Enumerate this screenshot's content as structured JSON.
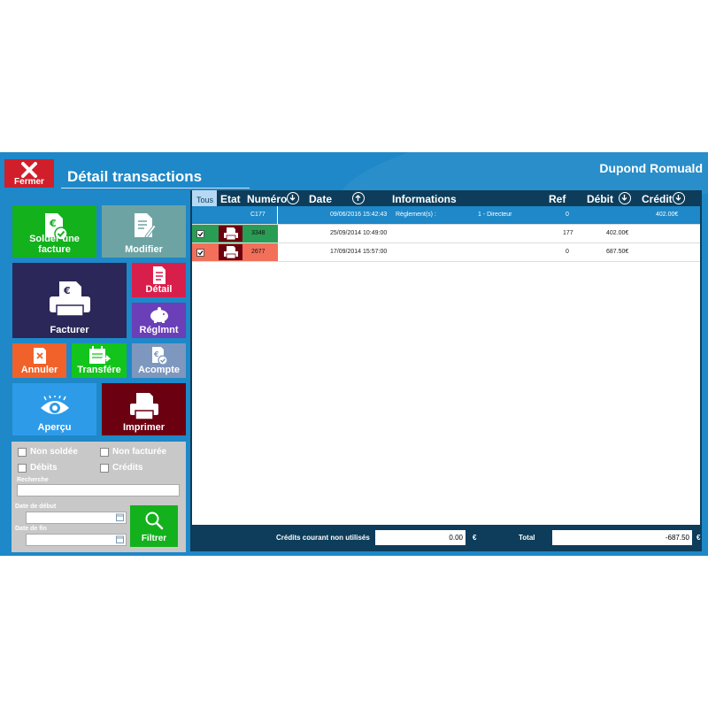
{
  "window": {
    "close_label": "Fermer",
    "title": "Détail transactions",
    "user": "Dupond Romuald"
  },
  "colors": {
    "background": "#1e88c8",
    "close": "#d01f2b",
    "table_header": "#0d3d5a",
    "selected_row": "#1e88c8"
  },
  "actions": {
    "solder": "Solder une facture",
    "modifier": "Modifier",
    "facturer": "Facturer",
    "detail": "Détail",
    "reglement": "Réglmnt",
    "annuler": "Annuler",
    "transfere": "Transfére",
    "acompte": "Acompte",
    "apercu": "Aperçu",
    "imprimer": "Imprimer"
  },
  "filters": {
    "non_soldee": "Non soldée",
    "non_facturee": "Non facturée",
    "debits": "Débits",
    "credits": "Crédits",
    "search_label": "Recherche",
    "start_label": "Date de début",
    "end_label": "Date de fin",
    "filter_button": "Filtrer"
  },
  "table": {
    "columns": {
      "all": "Tous",
      "etat": "Etat",
      "numero": "Numéro",
      "date": "Date",
      "informations": "Informations",
      "ref": "Ref",
      "debit": "Débit",
      "credit": "Crédit"
    },
    "rows": [
      {
        "numero": "C177",
        "date": "09/06/2016 15:42:43",
        "info": "Règlement(s) :",
        "info2": "1 - Directeur",
        "ref": "0",
        "debit": "",
        "credit": "402.00€",
        "state_color": "",
        "checked": false
      },
      {
        "numero": "3348",
        "date": "25/09/2014 10:49:00",
        "info": "",
        "info2": "",
        "ref": "177",
        "debit": "402.00€",
        "credit": "",
        "state_color": "#2a9d55",
        "checked": true
      },
      {
        "numero": "2677",
        "date": "17/09/2014 15:57:00",
        "info": "",
        "info2": "",
        "ref": "0",
        "debit": "687.50€",
        "credit": "",
        "state_color": "#f2705a",
        "checked": true
      }
    ]
  },
  "footer": {
    "credits_label": "Crédits courant non utilisés",
    "credits_value": "0.00",
    "currency": "€",
    "total_label": "Total",
    "total_value": "-687.50"
  }
}
